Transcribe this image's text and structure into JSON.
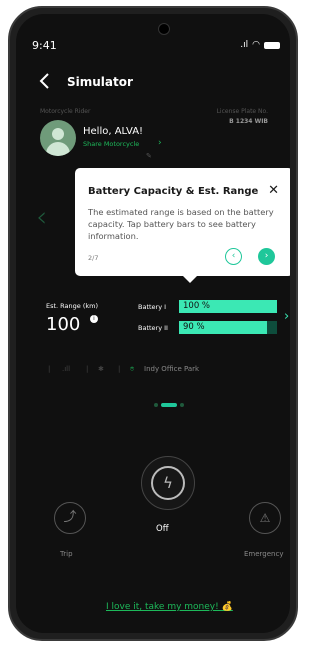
{
  "status_bar": {
    "time": "9:41"
  },
  "header": {
    "title": "Simulator"
  },
  "rider": {
    "label": "Motorcycle Rider",
    "greeting": "Hello, ALVA!",
    "share_label": "Share Motorcycle",
    "plate_label": "License Plate No.",
    "plate_value": "B 1234 WIB"
  },
  "tooltip": {
    "title": "Battery Capacity & Est. Range",
    "body": "The estimated range is based on the battery capacity. Tap battery bars to see battery information.",
    "step": "2/7"
  },
  "battery": {
    "range_label": "Est. Range (km)",
    "range_value": "100",
    "battery1_label": "Battery I",
    "battery1_text": "100 %",
    "battery1_level": 1.0,
    "battery2_label": "Battery II",
    "battery2_text": "90 %",
    "battery2_level": 0.9
  },
  "info_row": {
    "location": "Indy Office Park"
  },
  "controls": {
    "power_label": "Off",
    "trip_label": "Trip",
    "emergency_label": "Emergency"
  },
  "bottom_link": "I love it, take my money! 💰",
  "colors": {
    "accent": "#1fc79a",
    "bar": "#3be8b4",
    "green_text": "#1db95a",
    "background": "#101010"
  }
}
